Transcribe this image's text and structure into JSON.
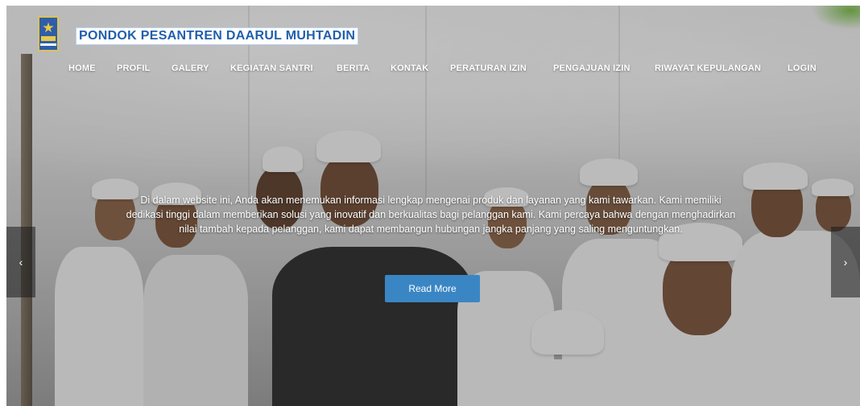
{
  "brand": {
    "logo_icon": "pesantren-logo-icon",
    "name": "PONDOK PESANTREN DAARUL MUHTADIN",
    "name_color": "#1f5fae"
  },
  "nav": {
    "items": [
      {
        "label": "HOME"
      },
      {
        "label": "PROFIL"
      },
      {
        "label": "GALERY"
      },
      {
        "label": "KEGIATAN SANTRI"
      },
      {
        "label": "BERITA"
      },
      {
        "label": "KONTAK"
      },
      {
        "label": "PERATURAN IZIN"
      },
      {
        "label": "PENGAJUAN IZIN"
      },
      {
        "label": "RIWAYAT KEPULANGAN"
      },
      {
        "label": "LOGIN"
      }
    ]
  },
  "hero": {
    "caption": "Di dalam website ini, Anda akan menemukan informasi lengkap mengenai produk dan layanan yang kami tawarkan. Kami memiliki dedikasi tinggi dalam memberikan solusi yang inovatif dan berkualitas bagi pelanggan kami. Kami percaya bahwa dengan menghadirkan nilai tambah kepada pelanggan, kami dapat membangun hubungan jangka panjang yang saling menguntungkan.",
    "button_label": "Read More",
    "button_color": "#3a86c4",
    "prev_icon": "‹",
    "next_icon": "›"
  }
}
